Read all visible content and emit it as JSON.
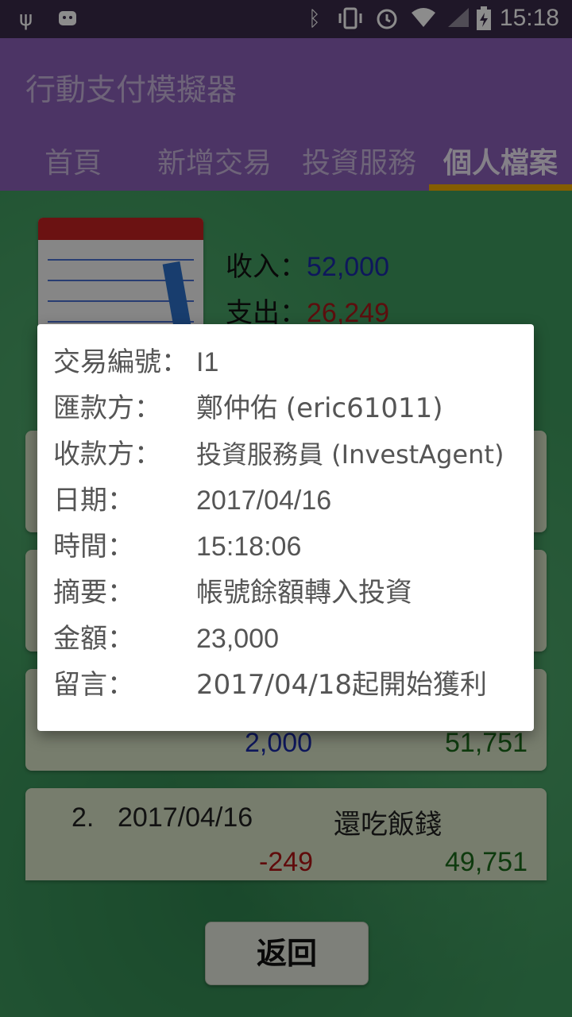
{
  "status_bar": {
    "time": "15:18",
    "icons": [
      "usb-icon",
      "android-icon",
      "bluetooth-icon",
      "vibrate-icon",
      "alarm-icon",
      "wifi-icon",
      "signal-icon",
      "battery-charging-icon"
    ]
  },
  "app": {
    "title": "行動支付模擬器",
    "tabs": [
      {
        "label": "首頁"
      },
      {
        "label": "新增交易"
      },
      {
        "label": "投資服務"
      },
      {
        "label": "個人檔案"
      }
    ]
  },
  "summary": {
    "income_label": "收入：",
    "income_value": "52,000",
    "expense_label": "支出：",
    "expense_value": "26,249"
  },
  "transactions": [
    {
      "amount": "2,000",
      "balance": "51,751"
    },
    {
      "index": "2.",
      "date": "2017/04/16",
      "description": "還吃飯錢",
      "amount": "-249",
      "balance": "49,751"
    }
  ],
  "back_button": "返回",
  "dialog": {
    "rows": [
      {
        "key": "交易編號：",
        "value": "I1"
      },
      {
        "key": "匯款方：",
        "value": "鄭仲佑 (eric61011)"
      },
      {
        "key": "收款方：",
        "value": "投資服務員 (InvestAgent)"
      },
      {
        "key": "日期：",
        "value": "2017/04/16"
      },
      {
        "key": "時間：",
        "value": "15:18:06"
      },
      {
        "key": "摘要：",
        "value": "帳號餘額轉入投資"
      },
      {
        "key": "金額：",
        "value": "23,000"
      },
      {
        "key": "留言：",
        "value": "2017/04/18起開始獲利"
      }
    ]
  }
}
